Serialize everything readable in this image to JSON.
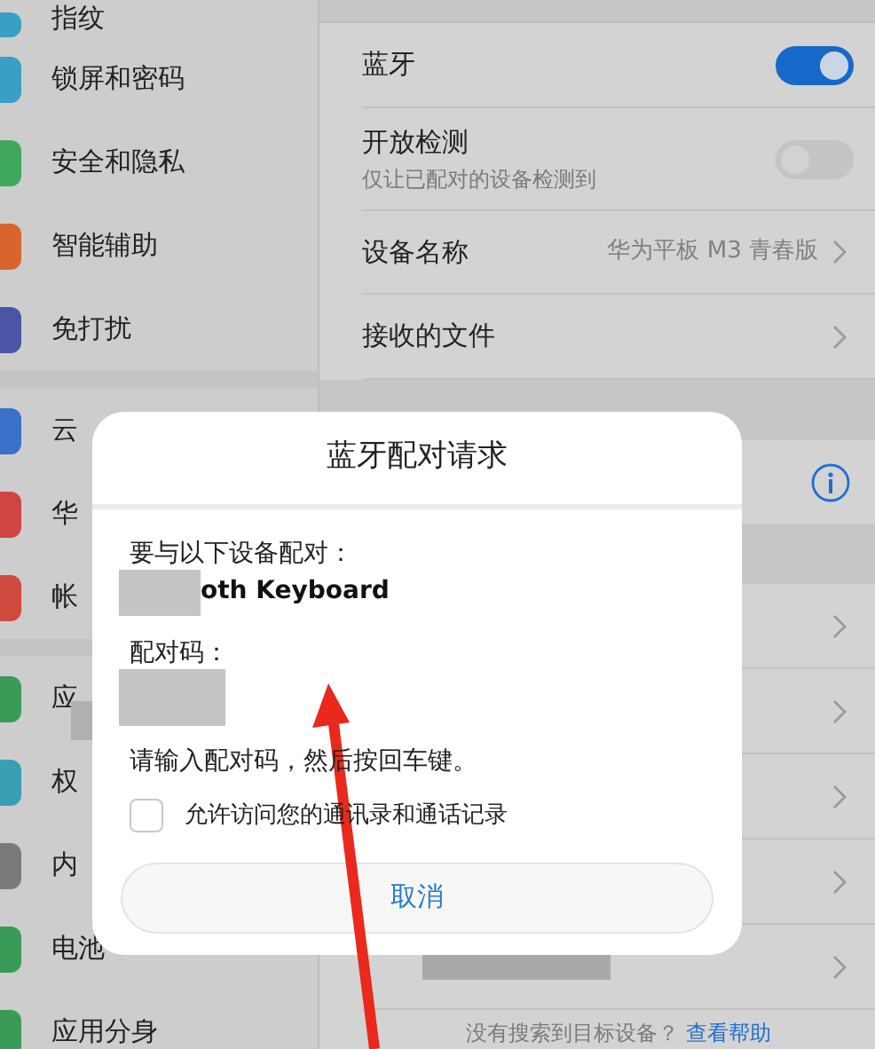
{
  "sidebar": {
    "groups": [
      {
        "items": [
          {
            "label": "指纹",
            "color": "#3a9fc4"
          },
          {
            "label": "锁屏和密码",
            "color": "#3a9fc4"
          },
          {
            "label": "安全和隐私",
            "color": "#3fa85c"
          },
          {
            "label": "智能辅助",
            "color": "#d9652e"
          },
          {
            "label": "免打扰",
            "color": "#4a55a8"
          }
        ]
      },
      {
        "items": [
          {
            "label": "云",
            "color": "#3a70c8"
          },
          {
            "label": "华",
            "color": "#d04444"
          },
          {
            "label": "帐",
            "color": "#d04a40"
          }
        ]
      },
      {
        "items": [
          {
            "label": "应",
            "color": "#3a9a58"
          },
          {
            "label": "权",
            "color": "#3a9fb4"
          },
          {
            "label": "内",
            "color": "#7a7a7a"
          },
          {
            "label": "电池",
            "color": "#3a9a58"
          },
          {
            "label": "应用分身",
            "color": "#3a9a58"
          }
        ]
      }
    ]
  },
  "settings": {
    "rows": [
      {
        "kind": "toggle",
        "label": "蓝牙",
        "on": true
      },
      {
        "kind": "toggle",
        "label": "开放检测",
        "subtitle": "仅让已配对的设备检测到",
        "on": false
      },
      {
        "kind": "value",
        "label": "设备名称",
        "value": "华为平板 M3 青春版"
      },
      {
        "kind": "link",
        "label": "接收的文件"
      },
      {
        "kind": "header"
      },
      {
        "kind": "info"
      },
      {
        "kind": "header"
      },
      {
        "kind": "link"
      },
      {
        "kind": "link"
      },
      {
        "kind": "link"
      },
      {
        "kind": "link"
      },
      {
        "kind": "redacted"
      }
    ],
    "footer": {
      "text": "没有搜索到目标设备？",
      "link": "查看帮助"
    }
  },
  "dialog": {
    "title": "蓝牙配对请求",
    "intro": "要与以下设备配对：",
    "device": "oth Keyboard",
    "code_label": "配对码：",
    "instruction": "请输入配对码，然后按回车键。",
    "checkbox": {
      "label": "允许访问您的通讯录和通话记录",
      "checked": false
    },
    "button": "取消"
  }
}
